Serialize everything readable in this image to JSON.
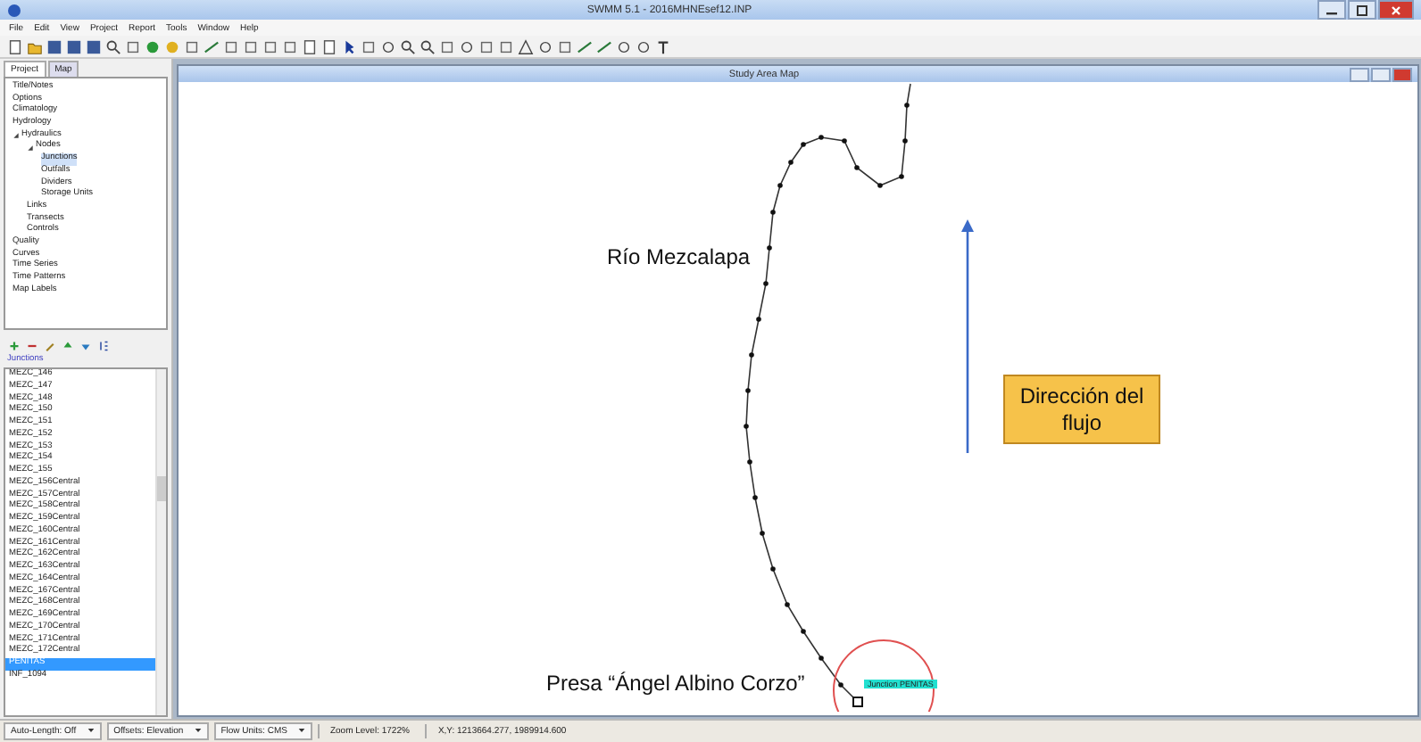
{
  "window": {
    "title": "SWMM 5.1 - 2016MHNEsef12.INP"
  },
  "menu": [
    "File",
    "Edit",
    "View",
    "Project",
    "Report",
    "Tools",
    "Window",
    "Help"
  ],
  "panel_tabs": [
    {
      "label": "Project",
      "selected": true
    },
    {
      "label": "Map",
      "selected": false
    }
  ],
  "tree": [
    {
      "label": "Title/Notes"
    },
    {
      "label": "Options"
    },
    {
      "label": "Climatology"
    },
    {
      "label": "Hydrology"
    },
    {
      "label": "Hydraulics",
      "expanded": true,
      "children": [
        {
          "label": "Nodes",
          "expanded": true,
          "children": [
            {
              "label": "Junctions",
              "selected": true
            },
            {
              "label": "Outfalls",
              "selected": false
            },
            {
              "label": "Dividers",
              "selected": false
            },
            {
              "label": "Storage Units",
              "selected": false
            }
          ]
        },
        {
          "label": "Links"
        },
        {
          "label": "Transects"
        },
        {
          "label": "Controls"
        }
      ]
    },
    {
      "label": "Quality"
    },
    {
      "label": "Curves"
    },
    {
      "label": "Time Series"
    },
    {
      "label": "Time Patterns"
    },
    {
      "label": "Map Labels"
    }
  ],
  "object_list": {
    "title": "Junctions",
    "items": [
      {
        "label": "MEZC_146",
        "selected": false
      },
      {
        "label": "MEZC_147",
        "selected": false
      },
      {
        "label": "MEZC_148",
        "selected": false
      },
      {
        "label": "MEZC_150",
        "selected": false
      },
      {
        "label": "MEZC_151",
        "selected": false
      },
      {
        "label": "MEZC_152",
        "selected": false
      },
      {
        "label": "MEZC_153",
        "selected": false
      },
      {
        "label": "MEZC_154",
        "selected": false
      },
      {
        "label": "MEZC_155",
        "selected": false
      },
      {
        "label": "MEZC_156Central",
        "selected": false
      },
      {
        "label": "MEZC_157Central",
        "selected": false
      },
      {
        "label": "MEZC_158Central",
        "selected": false
      },
      {
        "label": "MEZC_159Central",
        "selected": false
      },
      {
        "label": "MEZC_160Central",
        "selected": false
      },
      {
        "label": "MEZC_161Central",
        "selected": false
      },
      {
        "label": "MEZC_162Central",
        "selected": false
      },
      {
        "label": "MEZC_163Central",
        "selected": false
      },
      {
        "label": "MEZC_164Central",
        "selected": false
      },
      {
        "label": "MEZC_167Central",
        "selected": false
      },
      {
        "label": "MEZC_168Central",
        "selected": false
      },
      {
        "label": "MEZC_169Central",
        "selected": false
      },
      {
        "label": "MEZC_170Central",
        "selected": false
      },
      {
        "label": "MEZC_171Central",
        "selected": false
      },
      {
        "label": "MEZC_172Central",
        "selected": false
      },
      {
        "label": "PENITAS",
        "selected": true
      },
      {
        "label": "INF_1094",
        "selected": false
      }
    ]
  },
  "map": {
    "title": "Study Area Map",
    "node_label": "Junction PENITAS",
    "annotations": {
      "river": "Río Mezcalapa",
      "flow": "Dirección del flujo",
      "dam": "Presa “Ángel Albino Corzo”"
    }
  },
  "status_bar": [
    {
      "kind": "dropdown",
      "text": "Auto-Length: Off"
    },
    {
      "kind": "dropdown",
      "text": "Offsets: Elevation"
    },
    {
      "kind": "dropdown",
      "text": "Flow Units: CMS"
    },
    {
      "kind": "text",
      "text": "Zoom Level: 1722%"
    },
    {
      "kind": "text",
      "text": "X,Y: 1213664.277, 1989914.600"
    }
  ]
}
